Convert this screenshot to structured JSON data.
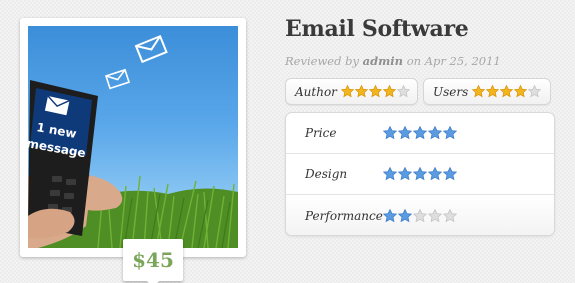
{
  "product": {
    "title": "Email Software",
    "price": "$45",
    "image_text": {
      "line1": "1 new",
      "line2": "message"
    }
  },
  "byline": {
    "prefix": "Reviewed by",
    "author": "admin",
    "date_prefix": "on",
    "date": "Apr 25, 2011"
  },
  "summary_ratings": [
    {
      "label": "Author",
      "rating": 4,
      "max": 5,
      "color": "#f3b51f"
    },
    {
      "label": "Users",
      "rating": 4,
      "max": 5,
      "color": "#f3b51f"
    }
  ],
  "detail_ratings": [
    {
      "label": "Price",
      "rating": 5,
      "max": 5,
      "color": "#5a9be2"
    },
    {
      "label": "Design",
      "rating": 5,
      "max": 5,
      "color": "#5a9be2"
    },
    {
      "label": "Performance",
      "rating": 2,
      "max": 5,
      "color": "#5a9be2"
    }
  ],
  "icons": [
    "envelope-icon",
    "star-icon",
    "phone-icon"
  ]
}
